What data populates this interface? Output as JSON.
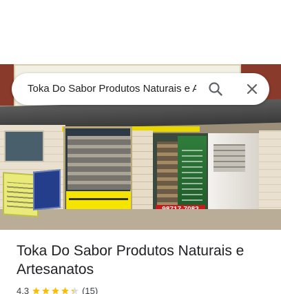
{
  "search": {
    "query": "Toka Do Sabor Produtos Naturais e Artesanatos"
  },
  "place": {
    "name": "Toka Do Sabor Produtos Naturais e Artesanatos",
    "rating": "4.3",
    "stars_filled": 4.3,
    "review_count": "(15)"
  },
  "photo": {
    "phone_plate": "98717-7082"
  },
  "colors": {
    "star": "#fbbc04",
    "star_empty": "#dadce0",
    "icon": "#5f6368"
  },
  "icons": {
    "search": "search-icon",
    "close": "close-icon",
    "star": "star-icon"
  }
}
